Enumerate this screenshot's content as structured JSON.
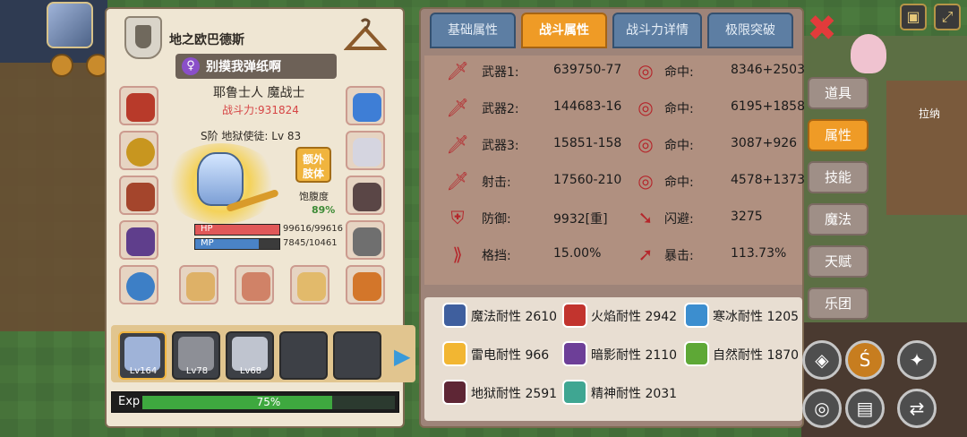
{
  "character": {
    "class_name": "地之欧巴德斯",
    "title": "别摸我弹纸啊",
    "gender_icon": "female-icon",
    "race_class": "耶鲁士人 魔战士",
    "power_label": "战斗力:931824",
    "tier_level": "S阶 地狱使徒: Lv 83",
    "extra_limb_line1": "额外",
    "extra_limb_line2": "肢体",
    "satiety_label": "饱腹度",
    "satiety_value": "89%",
    "hp_label": "HP",
    "hp_value": "99616/99616",
    "hp_fraction": 1.0,
    "mp_label": "MP",
    "mp_value": "7845/10461",
    "mp_fraction": 0.75
  },
  "party": [
    {
      "level": "Lv164",
      "selected": true
    },
    {
      "level": "Lv78",
      "selected": false
    },
    {
      "level": "Lv68",
      "selected": false
    },
    {
      "level": "",
      "selected": false
    },
    {
      "level": "",
      "selected": false
    }
  ],
  "exp": {
    "label": "Exp",
    "percent_text": "75%",
    "fraction": 0.75
  },
  "tabs": [
    {
      "label": "基础属性",
      "active": false
    },
    {
      "label": "战斗属性",
      "active": true
    },
    {
      "label": "战斗力详情",
      "active": false
    },
    {
      "label": "极限突破",
      "active": false
    }
  ],
  "combat_stats": {
    "left": [
      {
        "icon": "sword-icon",
        "label": "武器1:",
        "value": "639750-77"
      },
      {
        "icon": "sword-icon",
        "label": "武器2:",
        "value": "144683-16"
      },
      {
        "icon": "sword-icon",
        "label": "武器3:",
        "value": "15851-158"
      },
      {
        "icon": "sword-icon",
        "label": "射击:",
        "value": "17560-210"
      },
      {
        "icon": "shield-icon",
        "label": "防御:",
        "value": "9932[重]"
      },
      {
        "icon": "block-icon",
        "label": "格挡:",
        "value": "15.00%"
      }
    ],
    "right": [
      {
        "icon": "target-icon",
        "label": "命中:",
        "value": "8346+2503"
      },
      {
        "icon": "target-icon",
        "label": "命中:",
        "value": "6195+1858"
      },
      {
        "icon": "target-icon",
        "label": "命中:",
        "value": "3087+926"
      },
      {
        "icon": "target-icon",
        "label": "命中:",
        "value": "4578+1373"
      },
      {
        "icon": "dodge-icon",
        "label": "闪避:",
        "value": "3275"
      },
      {
        "icon": "crit-icon",
        "label": "暴击:",
        "value": "113.73%"
      }
    ]
  },
  "resistances": [
    {
      "icon": "magic-icon",
      "text": "魔法耐性 2610",
      "color": "#3f5f9e"
    },
    {
      "icon": "fire-icon",
      "text": "火焰耐性 2942",
      "color": "#c2342e"
    },
    {
      "icon": "ice-icon",
      "text": "寒冰耐性 1205",
      "color": "#3c8ecf"
    },
    {
      "icon": "thunder-icon",
      "text": "雷电耐性 966",
      "color": "#f2b632"
    },
    {
      "icon": "shadow-icon",
      "text": "暗影耐性 2110",
      "color": "#6d3f98"
    },
    {
      "icon": "nature-icon",
      "text": "自然耐性 1870",
      "color": "#5ea836"
    },
    {
      "icon": "hell-icon",
      "text": "地狱耐性 2591",
      "color": "#5e2635"
    },
    {
      "icon": "spirit-icon",
      "text": "精神耐性 2031",
      "color": "#3fa692"
    }
  ],
  "side_menu": [
    {
      "label": "道具",
      "active": false
    },
    {
      "label": "属性",
      "active": true
    },
    {
      "label": "技能",
      "active": false
    },
    {
      "label": "魔法",
      "active": false
    },
    {
      "label": "天赋",
      "active": false
    },
    {
      "label": "乐团",
      "active": false
    }
  ],
  "world": {
    "npc_name": "拉纳"
  }
}
